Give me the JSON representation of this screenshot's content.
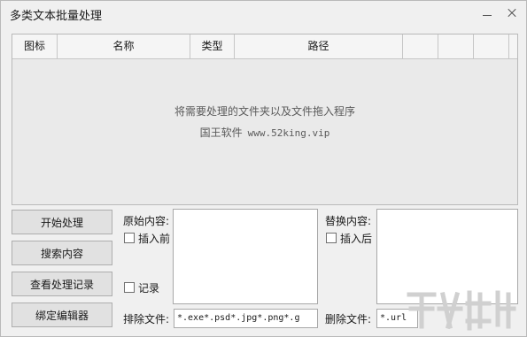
{
  "window": {
    "title": "多类文本批量处理"
  },
  "list": {
    "columns": [
      "图标",
      "名称",
      "类型",
      "路径",
      "",
      "",
      ""
    ],
    "hint": "将需要处理的文件夹以及文件拖入程序",
    "brand_name": "国王软件",
    "brand_url": "www.52king.vip"
  },
  "buttons": {
    "start": "开始处理",
    "search": "搜索内容",
    "view_log": "查看处理记录",
    "bind_editor": "绑定编辑器"
  },
  "original": {
    "label": "原始内容:",
    "insert_before": "插入前",
    "record": "记录"
  },
  "replace": {
    "label": "替换内容:",
    "insert_after": "插入后"
  },
  "exclude_files": {
    "label": "排除文件:",
    "value": "*.exe*.psd*.jpg*.png*.g"
  },
  "delete_files": {
    "label": "删除文件:",
    "value": "*.url"
  }
}
